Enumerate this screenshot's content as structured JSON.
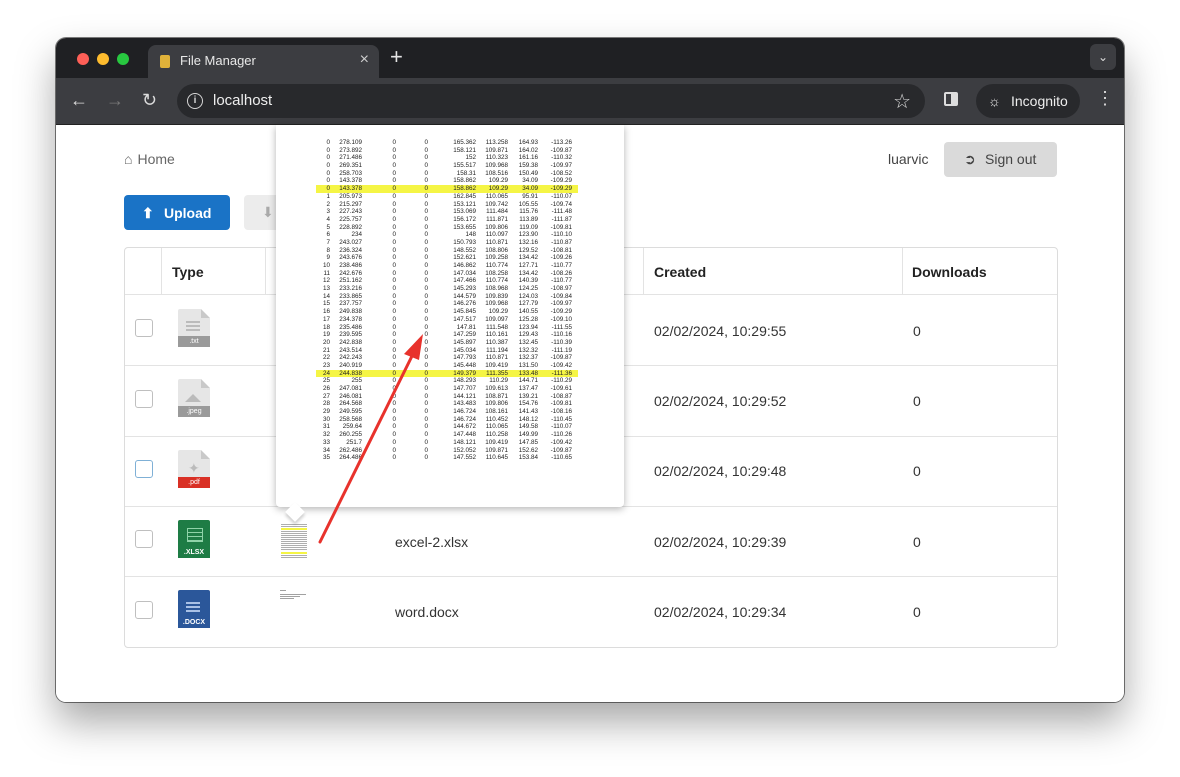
{
  "browser": {
    "tab_title": "File Manager",
    "tab_close": "×",
    "new_tab": "+",
    "tab_menu": "⌄",
    "url": "localhost",
    "incognito_label": "Incognito",
    "back": "←",
    "forward": "→",
    "reload": "↻",
    "star": "☆",
    "menu": "⋮",
    "info": "i"
  },
  "header": {
    "home_label": "Home",
    "username": "luarvic",
    "signout_label": "Sign out"
  },
  "toolbar": {
    "upload_label": "Upload"
  },
  "table": {
    "headers": [
      "Type",
      "",
      "",
      "Created",
      "Downloads"
    ],
    "rows": [
      {
        "ext": ".txt",
        "ext_color": "#9a9a9a",
        "name": "",
        "created": "02/02/2024, 10:29:55",
        "downloads": "0"
      },
      {
        "ext": ".jpeg",
        "ext_color": "#9a9a9a",
        "name": "",
        "created": "02/02/2024, 10:29:52",
        "downloads": "0"
      },
      {
        "ext": ".pdf",
        "ext_color": "#d93025",
        "name": "",
        "created": "02/02/2024, 10:29:48",
        "downloads": "0"
      },
      {
        "ext": ".XLSX",
        "ext_color": "#1e7c45",
        "name": "excel-2.xlsx",
        "created": "02/02/2024, 10:29:39",
        "downloads": "0"
      },
      {
        "ext": ".DOCX",
        "ext_color": "#2b579a",
        "name": "word.docx",
        "created": "02/02/2024, 10:29:34",
        "downloads": "0"
      }
    ]
  },
  "preview": {
    "highlighted_rows": [
      6,
      30
    ],
    "rows": [
      [
        "0",
        "278.109",
        "0",
        "0",
        "165.362",
        "113.258",
        "164.93",
        "-113.26"
      ],
      [
        "0",
        "273.892",
        "0",
        "0",
        "158.121",
        "109.871",
        "164.02",
        "-109.87"
      ],
      [
        "0",
        "271.486",
        "0",
        "0",
        "152",
        "110.323",
        "161.16",
        "-110.32"
      ],
      [
        "0",
        "269.351",
        "0",
        "0",
        "155.517",
        "109.968",
        "159.38",
        "-109.97"
      ],
      [
        "0",
        "258.703",
        "0",
        "0",
        "158.31",
        "108.516",
        "150.49",
        "-108.52"
      ],
      [
        "0",
        "143.378",
        "0",
        "0",
        "158.862",
        "109.29",
        "34.09",
        "-109.29"
      ],
      [
        "0",
        "143.378",
        "0",
        "0",
        "158.862",
        "109.29",
        "34.09",
        "-109.29"
      ],
      [
        "1",
        "205.973",
        "0",
        "0",
        "162.845",
        "110.065",
        "95.91",
        "-110.07"
      ],
      [
        "2",
        "215.297",
        "0",
        "0",
        "153.121",
        "109.742",
        "105.55",
        "-109.74"
      ],
      [
        "3",
        "227.243",
        "0",
        "0",
        "153.069",
        "111.484",
        "115.76",
        "-111.48"
      ],
      [
        "4",
        "225.757",
        "0",
        "0",
        "156.172",
        "111.871",
        "113.89",
        "-111.87"
      ],
      [
        "5",
        "228.892",
        "0",
        "0",
        "153.655",
        "109.806",
        "119.09",
        "-109.81"
      ],
      [
        "6",
        "234",
        "0",
        "0",
        "148",
        "110.097",
        "123.90",
        "-110.10"
      ],
      [
        "7",
        "243.027",
        "0",
        "0",
        "150.793",
        "110.871",
        "132.16",
        "-110.87"
      ],
      [
        "8",
        "236.324",
        "0",
        "0",
        "148.552",
        "108.806",
        "129.52",
        "-108.81"
      ],
      [
        "9",
        "243.676",
        "0",
        "0",
        "152.621",
        "109.258",
        "134.42",
        "-109.26"
      ],
      [
        "10",
        "238.486",
        "0",
        "0",
        "146.862",
        "110.774",
        "127.71",
        "-110.77"
      ],
      [
        "11",
        "242.676",
        "0",
        "0",
        "147.034",
        "108.258",
        "134.42",
        "-108.26"
      ],
      [
        "12",
        "251.162",
        "0",
        "0",
        "147.466",
        "110.774",
        "140.39",
        "-110.77"
      ],
      [
        "13",
        "233.216",
        "0",
        "0",
        "145.293",
        "108.968",
        "124.25",
        "-108.97"
      ],
      [
        "14",
        "233.865",
        "0",
        "0",
        "144.579",
        "109.839",
        "124.03",
        "-109.84"
      ],
      [
        "15",
        "237.757",
        "0",
        "0",
        "146.276",
        "109.968",
        "127.79",
        "-109.97"
      ],
      [
        "16",
        "249.838",
        "0",
        "0",
        "145.845",
        "109.29",
        "140.55",
        "-109.29"
      ],
      [
        "17",
        "234.378",
        "0",
        "0",
        "147.517",
        "109.097",
        "125.28",
        "-109.10"
      ],
      [
        "18",
        "235.486",
        "0",
        "0",
        "147.81",
        "111.548",
        "123.94",
        "-111.55"
      ],
      [
        "19",
        "239.595",
        "0",
        "0",
        "147.259",
        "110.161",
        "129.43",
        "-110.16"
      ],
      [
        "20",
        "242.838",
        "0",
        "0",
        "145.897",
        "110.387",
        "132.45",
        "-110.39"
      ],
      [
        "21",
        "243.514",
        "0",
        "0",
        "145.034",
        "111.194",
        "132.32",
        "-111.19"
      ],
      [
        "22",
        "242.243",
        "0",
        "0",
        "147.793",
        "110.871",
        "132.37",
        "-109.87"
      ],
      [
        "23",
        "240.919",
        "0",
        "0",
        "145.448",
        "109.419",
        "131.50",
        "-109.42"
      ],
      [
        "24",
        "244.838",
        "0",
        "0",
        "149.379",
        "111.355",
        "133.48",
        "-111.36"
      ],
      [
        "25",
        "255",
        "0",
        "0",
        "148.293",
        "110.29",
        "144.71",
        "-110.29"
      ],
      [
        "26",
        "247.081",
        "0",
        "0",
        "147.707",
        "109.613",
        "137.47",
        "-109.61"
      ],
      [
        "27",
        "246.081",
        "0",
        "0",
        "144.121",
        "108.871",
        "139.21",
        "-108.87"
      ],
      [
        "28",
        "264.568",
        "0",
        "0",
        "143.483",
        "109.806",
        "154.76",
        "-109.81"
      ],
      [
        "29",
        "249.595",
        "0",
        "0",
        "146.724",
        "108.161",
        "141.43",
        "-108.16"
      ],
      [
        "30",
        "258.568",
        "0",
        "0",
        "146.724",
        "110.452",
        "148.12",
        "-110.45"
      ],
      [
        "31",
        "259.64",
        "0",
        "0",
        "144.672",
        "110.065",
        "149.58",
        "-110.07"
      ],
      [
        "32",
        "260.255",
        "0",
        "0",
        "147.448",
        "110.258",
        "149.99",
        "-110.26"
      ],
      [
        "33",
        "251.7",
        "0",
        "0",
        "148.121",
        "109.419",
        "147.85",
        "-109.42"
      ],
      [
        "34",
        "262.486",
        "0",
        "0",
        "152.052",
        "109.871",
        "152.62",
        "-109.87"
      ],
      [
        "35",
        "264.486",
        "0",
        "0",
        "147.552",
        "110.645",
        "153.84",
        "-110.65"
      ]
    ]
  },
  "colors": {
    "upload_button": "#1a73c6",
    "highlight": "#f5f545",
    "arrow": "#e8322c"
  }
}
